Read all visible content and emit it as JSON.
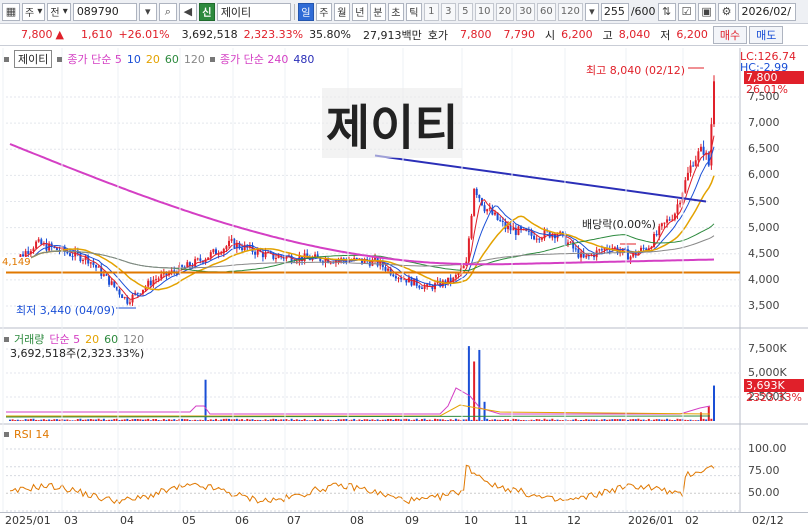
{
  "toolbar": {
    "market": "주",
    "type": "전",
    "code": "089790",
    "name": "제이티",
    "name_prefix": "신",
    "periods": [
      "일",
      "주",
      "월",
      "년",
      "분",
      "초",
      "틱"
    ],
    "active_period": "일",
    "intervals": [
      "1",
      "3",
      "5",
      "10",
      "20",
      "30",
      "60",
      "120"
    ],
    "count": "255",
    "count_total": "/600",
    "date": "2026/02/"
  },
  "quote": {
    "price": "7,800",
    "arrow": "▲",
    "change": "1,610",
    "change_pct": "+26.01%",
    "volume": "3,692,518",
    "vol_ratio": "2,323.33%",
    "turnover": "35.80%",
    "amount": "27,913백만",
    "hoga_label": "호가",
    "ask": "7,800",
    "bid": "7,790",
    "open_label": "시",
    "open": "6,200",
    "high_label": "고",
    "high": "8,040",
    "low_label": "저",
    "low": "6,200",
    "buy_btn": "매수",
    "sell_btn": "매도"
  },
  "price_panel": {
    "legend_name": "제이티",
    "legend_ma": "종가 단순 5",
    "legend_periods": [
      "10",
      "20",
      "60",
      "120"
    ],
    "legend_ma2": "종가 단순 240",
    "legend_ma2_period": "480",
    "watermark": "제이티",
    "high_note": "최고 8,040 (02/12)",
    "low_note": "최저 3,440 (04/09)",
    "dividend_note": "배당락(0.00%)",
    "lc": "LC:126.74",
    "hc": "HC:-2.99",
    "current_tag": "7,800",
    "current_pct": "26.01%",
    "left_edge_value": "4,149",
    "y_ticks": [
      "7,500",
      "7,000",
      "6,500",
      "6,000",
      "5,500",
      "5,000",
      "4,500",
      "4,000",
      "3,500"
    ]
  },
  "volume_panel": {
    "legend_name": "거래량",
    "legend_ma": "단순 5",
    "legend_periods": [
      "20",
      "60",
      "120"
    ],
    "value_line": "3,692,518주(2,323.33%)",
    "y_ticks": [
      "7,500K",
      "5,000K",
      "2,500K"
    ],
    "current_tag": "3,693K",
    "current_pct": "2323.33%"
  },
  "rsi_panel": {
    "legend_name": "RSI 14",
    "y_ticks": [
      "100.00",
      "75.00",
      "50.00"
    ]
  },
  "x_axis": [
    "2025/01",
    "03",
    "04",
    "05",
    "06",
    "07",
    "08",
    "09",
    "10",
    "11",
    "12",
    "2026/01",
    "02",
    "02/12"
  ],
  "colors": {
    "up": "#e0202a",
    "down": "#1a4fd6",
    "ma5": "#e0202a",
    "ma10": "#1a4fd6",
    "ma20": "#e3a200",
    "ma60": "#2d8a3e",
    "ma120": "#888888",
    "ma240": "#d43fc4",
    "ma480": "#2b2fb8",
    "support": "#e07800"
  }
}
